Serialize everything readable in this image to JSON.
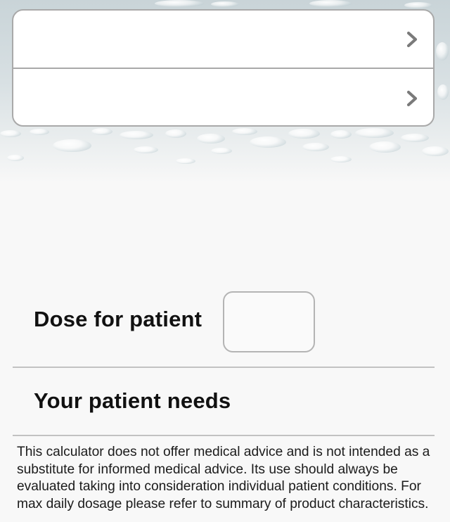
{
  "menu": {
    "items": [
      {
        "label": "",
        "icon": "chevron-right-icon"
      },
      {
        "label": "",
        "icon": "chevron-right-icon"
      }
    ]
  },
  "dose": {
    "label": "Dose for patient",
    "value": ""
  },
  "needs": {
    "label": "Your patient needs"
  },
  "disclaimer": "This calculator does not offer medical advice and is not intended as a substitute for informed medical advice. Its use should always be evaluated taking into consideration individual patient conditions. For max daily dosage please refer to summary of product characteristics.",
  "colors": {
    "background": "#f8f8f8",
    "border": "#a9a9a9",
    "text": "#111111",
    "chevron": "#7a7a7a"
  }
}
